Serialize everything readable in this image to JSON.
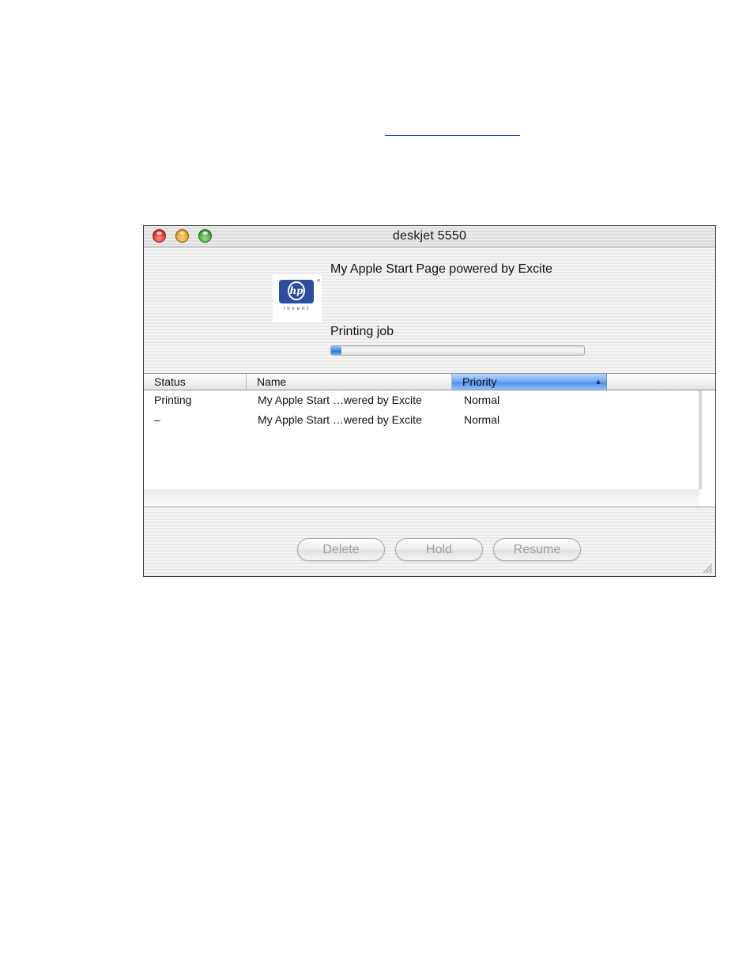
{
  "window": {
    "title": "deskjet 5550"
  },
  "logo": {
    "badge_text": "hp",
    "tagline": "invent",
    "mark": "®"
  },
  "job": {
    "title": "My Apple Start Page powered by Excite",
    "status": "Printing job",
    "progress_fraction": 0.04
  },
  "queue": {
    "columns": [
      {
        "label": "Status"
      },
      {
        "label": "Name"
      },
      {
        "label": "Priority",
        "sorted": true,
        "sort_direction": "ascending"
      }
    ],
    "rows": [
      {
        "status": "Printing",
        "name": "My Apple Start …wered by Excite",
        "priority": "Normal"
      },
      {
        "status": "–",
        "name": "My Apple Start …wered by Excite",
        "priority": "Normal"
      }
    ]
  },
  "buttons": {
    "delete": "Delete",
    "hold": "Hold",
    "resume": "Resume"
  },
  "colors": {
    "accent_blue": "#4f8fe8",
    "hp_blue": "#2a4f9c",
    "close_red": "#d8261c",
    "minimize_yellow": "#e39a12",
    "zoom_green": "#3a9c2c"
  }
}
